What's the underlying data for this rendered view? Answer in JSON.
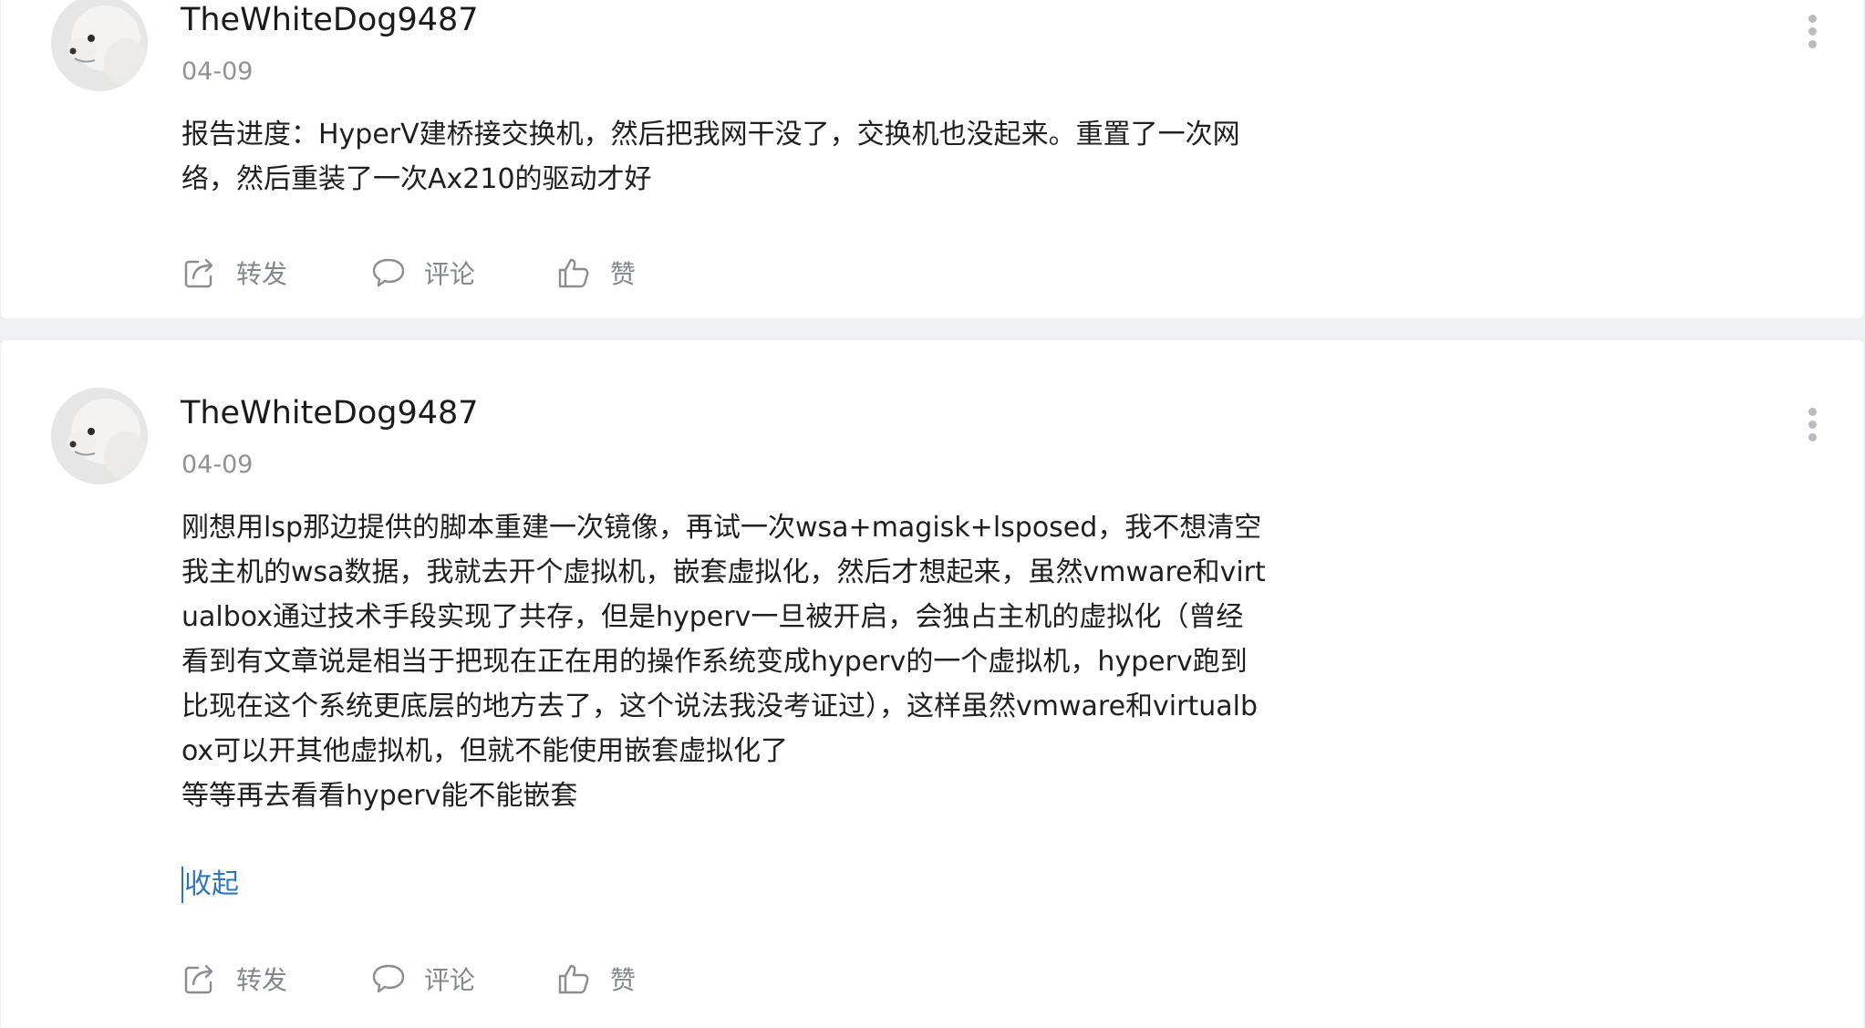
{
  "posts": [
    {
      "username": "TheWhiteDog9487",
      "date": "04-09",
      "content": "报告进度：HyperV建桥接交换机，然后把我网干没了，交换机也没起来。重置了一次网络，然后重装了一次Ax210的驱动才好",
      "collapse_label": "",
      "actions": {
        "repost": "转发",
        "comment": "评论",
        "like": "赞"
      }
    },
    {
      "username": "TheWhiteDog9487",
      "date": "04-09",
      "content": "刚想用lsp那边提供的脚本重建一次镜像，再试一次wsa+magisk+lsposed，我不想清空我主机的wsa数据，我就去开个虚拟机，嵌套虚拟化，然后才想起来，虽然vmware和virtualbox通过技术手段实现了共存，但是hyperv一旦被开启，会独占主机的虚拟化（曾经看到有文章说是相当于把现在正在用的操作系统变成hyperv的一个虚拟机，hyperv跑到比现在这个系统更底层的地方去了，这个说法我没考证过），这样虽然vmware和virtualbox可以开其他虚拟机，但就不能使用嵌套虚拟化了\n等等再去看看hyperv能不能嵌套",
      "collapse_label": "收起",
      "actions": {
        "repost": "转发",
        "comment": "评论",
        "like": "赞"
      }
    }
  ],
  "icons": {
    "more": "more-vertical-icon",
    "repost": "repost-icon",
    "comment": "comment-icon",
    "like": "thumbs-up-icon"
  },
  "colors": {
    "link": "#2f74c0",
    "muted": "#838790",
    "background": "#f0f1f4"
  }
}
